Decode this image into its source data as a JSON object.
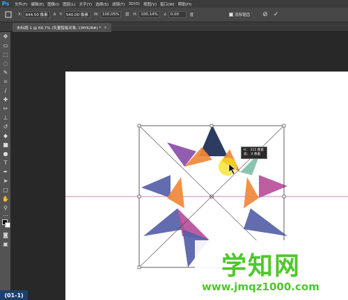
{
  "app": {
    "logo": "Ps"
  },
  "menu": [
    "文件(F)",
    "编辑(E)",
    "图像(I)",
    "图层(L)",
    "文字(Y)",
    "选择(S)",
    "滤镜(T)",
    "3D(D)",
    "视图(V)",
    "窗口(W)",
    "帮助(H)"
  ],
  "options": {
    "x_label": "X:",
    "x_value": "644.50 像素",
    "y_label": "Y:",
    "y_value": "540.00 像素",
    "w_label": "W:",
    "w_value": "100.05%",
    "h_label": "H:",
    "h_value": "100.14%",
    "angle_value": "0.00",
    "angle_unit": "度",
    "warp_label": "消除锯齿",
    "cancel_icon": "cancel-icon",
    "commit_icon": "commit-icon"
  },
  "tab": {
    "title": "未标题-1 @ 66.7% (矢量智能对象, CMYK/8#) *",
    "close": "×"
  },
  "tooltip": {
    "line1": "H：  315  像素",
    "line2": "高：   0  像素"
  },
  "watermark": {
    "title": "学知网",
    "url": "www.jmqz1000.com"
  },
  "corner_badge": "(01-1)",
  "colors": {
    "navy": "#1b2a52",
    "purple": "#8a4fa8",
    "orange": "#f0883a",
    "periwinkle": "#5660a8",
    "magenta": "#b84f9a",
    "teal": "#7fbfaa",
    "guide": "#b05a9c"
  }
}
